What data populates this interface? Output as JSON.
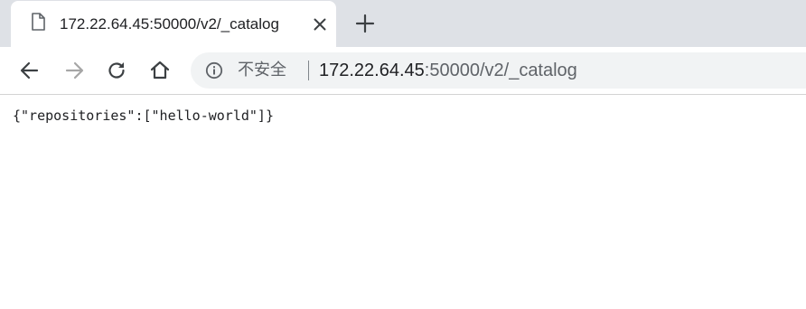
{
  "tab": {
    "title": "172.22.64.45:50000/v2/_catalog",
    "favicon": "document-icon",
    "close": "close-icon"
  },
  "toolbar": {
    "back": "back-arrow-icon",
    "forward": "forward-arrow-icon",
    "reload": "reload-icon",
    "home": "home-icon",
    "new_tab": "plus-icon"
  },
  "omnibox": {
    "security_icon": "info-icon",
    "security_label": "不安全",
    "url_host": "172.22.64.45",
    "url_rest": ":50000/v2/_catalog"
  },
  "page": {
    "body_text": "{\"repositories\":[\"hello-world\"]}"
  },
  "colors": {
    "tabstrip": "#dee1e6",
    "omnibox": "#f1f3f4",
    "text_primary": "#202124",
    "text_secondary": "#5f6368",
    "icon_disabled": "#a6a6a6"
  }
}
